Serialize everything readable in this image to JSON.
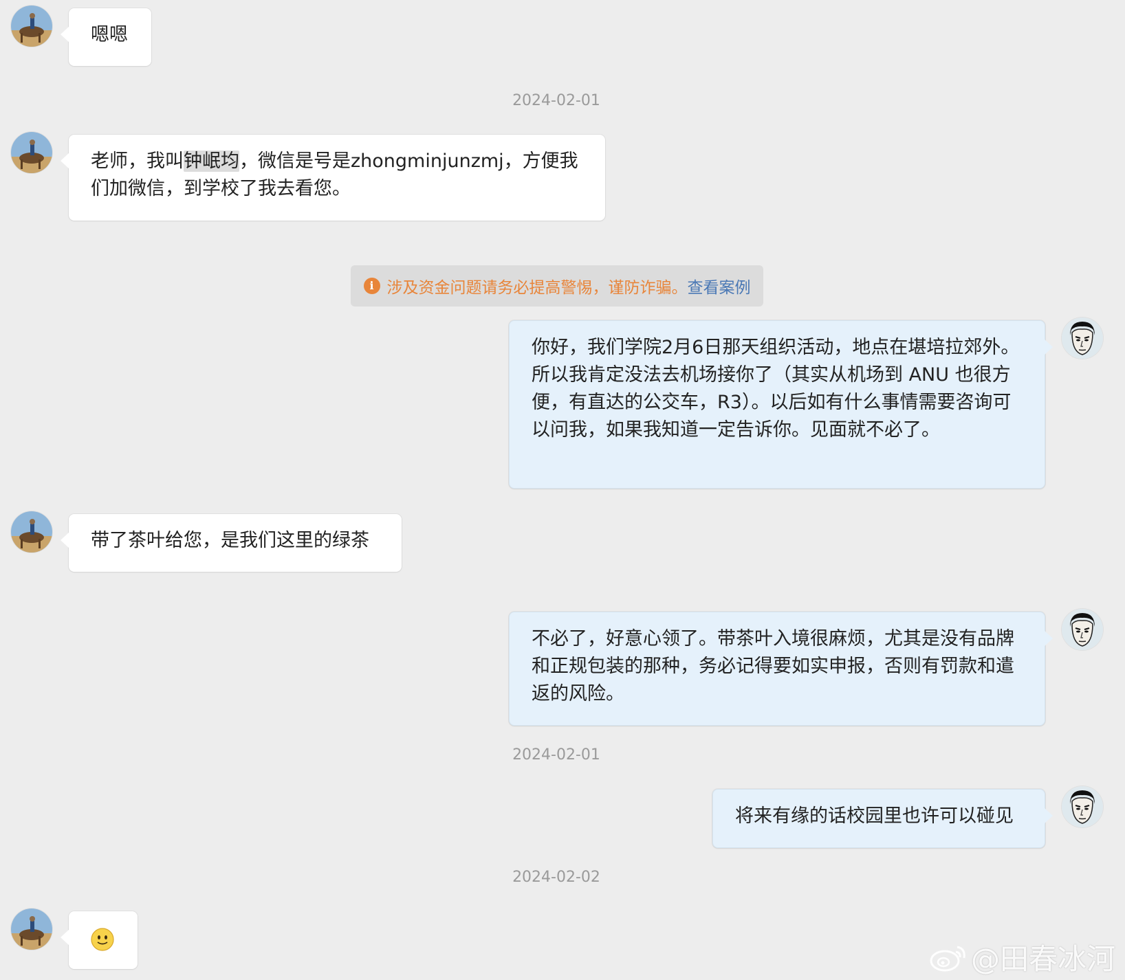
{
  "messages": {
    "m1": {
      "text": "嗯嗯"
    },
    "date1": "2024-02-01",
    "m2": {
      "pre": "老师，我叫",
      "name": "钟岷均",
      "post": "，微信是号是zhongminjunzmj，方便我们加微信，到学校了我去看您。"
    },
    "warning": {
      "text": "涉及资金问题请务必提高警惕，谨防诈骗。",
      "link": "查看案例",
      "icon": "info-icon"
    },
    "m3": {
      "text": "你好，我们学院2月6日那天组织活动，地点在堪培拉郊外。所以我肯定没法去机场接你了（其实从机场到 ANU 也很方便，有直达的公交车，R3）。以后如有什么事情需要咨询可以问我，如果我知道一定告诉你。见面就不必了。"
    },
    "m4": {
      "text": "带了茶叶给您，是我们这里的绿茶"
    },
    "m5": {
      "text": "不必了，好意心领了。带茶叶入境很麻烦，尤其是没有品牌和正规包装的那种，务必记得要如实申报，否则有罚款和遣返的风险。"
    },
    "date2": "2024-02-01",
    "m6": {
      "text": "将来有缘的话校园里也许可以碰见"
    },
    "date3": "2024-02-02",
    "m7": {
      "emoji": "smile-emoji"
    }
  },
  "watermark": {
    "text": "@田春冰河",
    "icon": "weibo-logo-icon"
  },
  "colors": {
    "background": "#ededed",
    "incoming_bubble": "#ffffff",
    "outgoing_bubble": "#e5f1fb",
    "warning_text": "#e8853a",
    "link": "#4a78b5",
    "date_text": "#9a9a9a"
  }
}
